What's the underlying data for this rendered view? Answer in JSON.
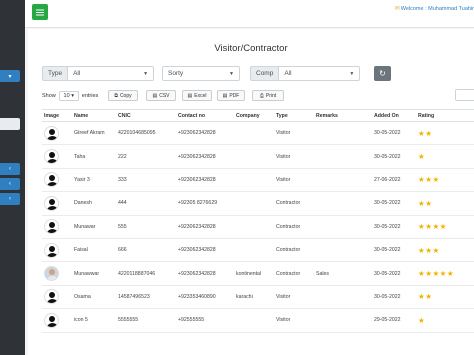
{
  "header": {
    "welcome_text": "Welcome : Muhammad Tuahir"
  },
  "page": {
    "title": "Visitor/Contractor"
  },
  "filters": {
    "type_label": "Type",
    "type_value": "All",
    "sort_value": "Sorty",
    "comp_label": "Comp",
    "comp_value": "All"
  },
  "table_controls": {
    "show_label": "Show",
    "length_value": "10",
    "entries_label": "entries",
    "copy_label": "Copy",
    "csv_label": "CSV",
    "excel_label": "Excel",
    "pdf_label": "PDF",
    "print_label": "Print"
  },
  "table": {
    "columns": [
      "Image",
      "Name",
      "CNIC",
      "Contact no",
      "Company",
      "Type",
      "Remarks",
      "Added On",
      "Rating"
    ],
    "rows": [
      {
        "name": "Gtreef Akram",
        "cnic": "4220104685095",
        "contact": "+923062342828",
        "company": "",
        "type": "Visitor",
        "remarks": "",
        "added_on": "30-05-2022",
        "rating": "★★",
        "photo": false
      },
      {
        "name": "Taha",
        "cnic": "222",
        "contact": "+923062342828",
        "company": "",
        "type": "Visitor",
        "remarks": "",
        "added_on": "30-05-2022",
        "rating": "★",
        "photo": false
      },
      {
        "name": "Yasir 3",
        "cnic": "333",
        "contact": "+923062342828",
        "company": "",
        "type": "Visitor",
        "remarks": "",
        "added_on": "27-06-2022",
        "rating": "★★★",
        "photo": false
      },
      {
        "name": "Danesh",
        "cnic": "444",
        "contact": "+92305 8276629",
        "company": "",
        "type": "Contractor",
        "remarks": "",
        "added_on": "30-05-2022",
        "rating": "★★",
        "photo": false
      },
      {
        "name": "Munawar",
        "cnic": "555",
        "contact": "+923062342828",
        "company": "",
        "type": "Contractor",
        "remarks": "",
        "added_on": "30-05-2022",
        "rating": "★★★★",
        "photo": false
      },
      {
        "name": "Faisal",
        "cnic": "666",
        "contact": "+923062342828",
        "company": "",
        "type": "Contractor",
        "remarks": "",
        "added_on": "30-05-2022",
        "rating": "★★★",
        "photo": false
      },
      {
        "name": "Munawwar",
        "cnic": "4220118887046",
        "contact": "+923062342828",
        "company": "kontinental",
        "type": "Contractor",
        "remarks": "Sales",
        "added_on": "30-05-2022",
        "rating": "★★★★★",
        "photo": true
      },
      {
        "name": "Osama",
        "cnic": "14587496523",
        "contact": "+923353460890",
        "company": "karachi",
        "type": "Visitor",
        "remarks": "",
        "added_on": "30-05-2022",
        "rating": "★★",
        "photo": false
      },
      {
        "name": "icon 5",
        "cnic": "5555555",
        "contact": "+92555555",
        "company": "",
        "type": "Visitor",
        "remarks": "",
        "added_on": "29-05-2022",
        "rating": "★",
        "photo": false
      }
    ]
  },
  "colors": {
    "sidebar": "#2f3337",
    "menu_button": "#28a745",
    "accent": "#2f7fc1",
    "star": "#f0b400"
  }
}
